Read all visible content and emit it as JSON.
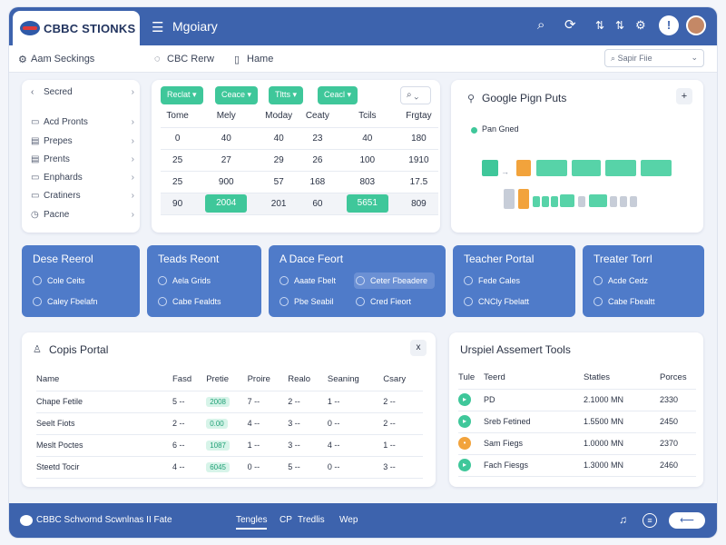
{
  "colors": {
    "accent": "#3d63ad",
    "green": "#3fc79a",
    "orange": "#f2a33c",
    "card_blue": "#4f7bc9"
  },
  "header": {
    "logo_text": "CBBC STIONKS",
    "title": "Mgoiary",
    "icons": [
      "search-icon",
      "refresh-icon",
      "sort-icon",
      "bell-icon",
      "avatar"
    ],
    "badge": "!"
  },
  "subnav": {
    "item1": "Aam Seckings",
    "item2": "CBC Rerw",
    "item3": "Hame",
    "select_value": "Sapir Fiie"
  },
  "sidebar": {
    "items": [
      {
        "label": "Secred",
        "icon": "chevron-left-icon"
      },
      {
        "label": "Acd Pronts",
        "icon": "folder-icon"
      },
      {
        "label": "Prepes",
        "icon": "doc-icon"
      },
      {
        "label": "Prents",
        "icon": "doc-icon"
      },
      {
        "label": "Enphards",
        "icon": "folder-icon"
      },
      {
        "label": "Cratiners",
        "icon": "folder-icon"
      },
      {
        "label": "Pacne",
        "icon": "clock-icon"
      }
    ]
  },
  "grid": {
    "chips": [
      "Reclat ▾",
      "Ceace ▾",
      "Tltts ▾",
      "Ceacl ▾"
    ],
    "headers": [
      "Tome",
      "Mely",
      "Moday",
      "Ceaty",
      "Tcils",
      "Frgtay"
    ],
    "rows": [
      [
        "0",
        "40",
        "40",
        "23",
        "40",
        "180"
      ],
      [
        "25",
        "27",
        "29",
        "26",
        "100",
        "1910"
      ],
      [
        "25",
        "900",
        "57",
        "168",
        "803",
        "17.5"
      ],
      [
        "90",
        "2004",
        "201",
        "60",
        "5651",
        "809"
      ]
    ]
  },
  "google": {
    "title": "Google Pign Puts",
    "legend": "Pan Gned",
    "plus": "+"
  },
  "blue_cards": [
    {
      "title": "Dese Reerol",
      "items": [
        "Cole Ceits",
        "Caley Fbelafn"
      ]
    },
    {
      "title": "Teads Reont",
      "items": [
        "Aela Grids",
        "Cabe Fealdts"
      ]
    },
    {
      "title": "A Dace Feort",
      "items": [
        "Aaate Fbelt",
        "Ceter Fbeadere",
        "Pbe Seabil",
        "Cred Fieort"
      ]
    },
    {
      "title": "Teacher Portal",
      "items": [
        "Fede Cales",
        "CNCly Fbelatt"
      ]
    },
    {
      "title": "Treater Torrl",
      "items": [
        "Acde Cedz",
        "Cabe Fbealtt"
      ]
    }
  ],
  "copis": {
    "title": "Copis Portal",
    "close": "x",
    "headers": [
      "Name",
      "Fasd",
      "Pretie",
      "Proire",
      "Realo",
      "Seaning",
      "Csary"
    ],
    "rows": [
      [
        "Chape Fetile",
        "5 --",
        "2008",
        "7 --",
        "2 --",
        "1 --",
        "2 --"
      ],
      [
        "Seelt Fiots",
        "2 --",
        "0.00",
        "4 --",
        "3 --",
        "0 --",
        "2 --"
      ],
      [
        "Meslt Poctes",
        "6 --",
        "1087",
        "1 --",
        "3 --",
        "4 --",
        "1 --"
      ],
      [
        "Steetd Tocir",
        "4 --",
        "6045",
        "0 --",
        "5 --",
        "0 --",
        "3 --"
      ]
    ]
  },
  "assess": {
    "title": "Urspiel Assemert Tools",
    "headers": [
      "Tule",
      "Teerd",
      "Statles",
      "Porces"
    ],
    "rows": [
      [
        "PD",
        "2.1000 MN",
        "2330"
      ],
      [
        "Sreb Fetined",
        "1.5500 MN",
        "2450"
      ],
      [
        "Sam Fiegs",
        "1.0000 MN",
        "2370"
      ],
      [
        "Fach Fiesgs",
        "1.3000 MN",
        "2460"
      ]
    ]
  },
  "footer": {
    "left": "CBBC Schvornd Scwnlnas II Fate",
    "tabs": [
      "Tengles",
      "CP",
      "Tredlis",
      "Wep"
    ],
    "icons": [
      "music-icon",
      "menu-icon",
      "toggle"
    ]
  }
}
